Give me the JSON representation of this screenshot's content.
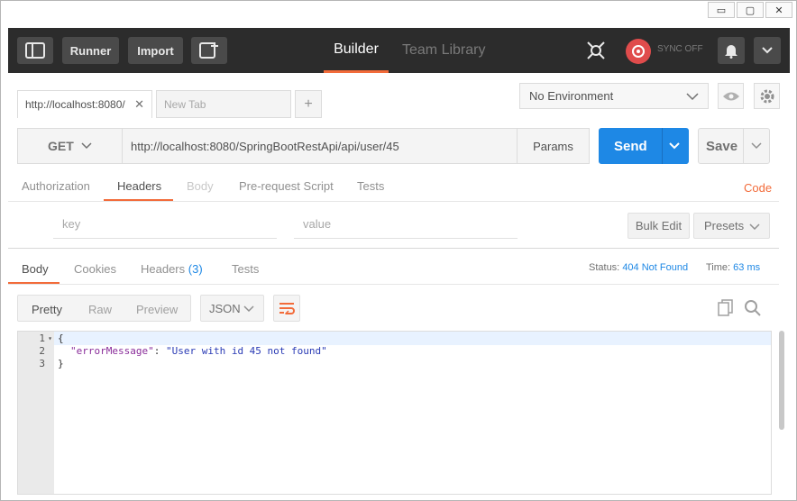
{
  "window": {
    "minimize": "▭",
    "maximize": "▢",
    "close": "✕"
  },
  "topbar": {
    "runner": "Runner",
    "import": "Import",
    "builder": "Builder",
    "team_library": "Team Library",
    "sync": "SYNC OFF"
  },
  "tabs": [
    {
      "label": "http://localhost:8080/",
      "active": true
    },
    {
      "label": "New Tab",
      "active": false
    }
  ],
  "environment": {
    "selected": "No Environment"
  },
  "request": {
    "method": "GET",
    "url": "http://localhost:8080/SpringBootRestApi/api/user/45",
    "params": "Params",
    "send": "Send",
    "save": "Save"
  },
  "request_tabs": [
    "Authorization",
    "Headers",
    "Body",
    "Pre-request Script",
    "Tests"
  ],
  "request_active_tab": "Headers",
  "code_link": "Code",
  "headers_editor": {
    "key_placeholder": "key",
    "value_placeholder": "value",
    "bulk_edit": "Bulk Edit",
    "presets": "Presets"
  },
  "response": {
    "tabs": {
      "body": "Body",
      "cookies": "Cookies",
      "headers": "Headers",
      "headers_count": "(3)",
      "tests": "Tests"
    },
    "status_label": "Status:",
    "status_value": "404 Not Found",
    "time_label": "Time:",
    "time_value": "63 ms",
    "views": {
      "pretty": "Pretty",
      "raw": "Raw",
      "preview": "Preview"
    },
    "format": "JSON",
    "lines": [
      "1",
      "2",
      "3"
    ],
    "body": {
      "open": "{",
      "key": "\"errorMessage\"",
      "colon": ": ",
      "value": "\"User with id 45 not found\"",
      "close": "}"
    }
  },
  "colors": {
    "accent": "#f26b3a",
    "primary": "#1e88e5",
    "sync": "#e04c4c"
  }
}
